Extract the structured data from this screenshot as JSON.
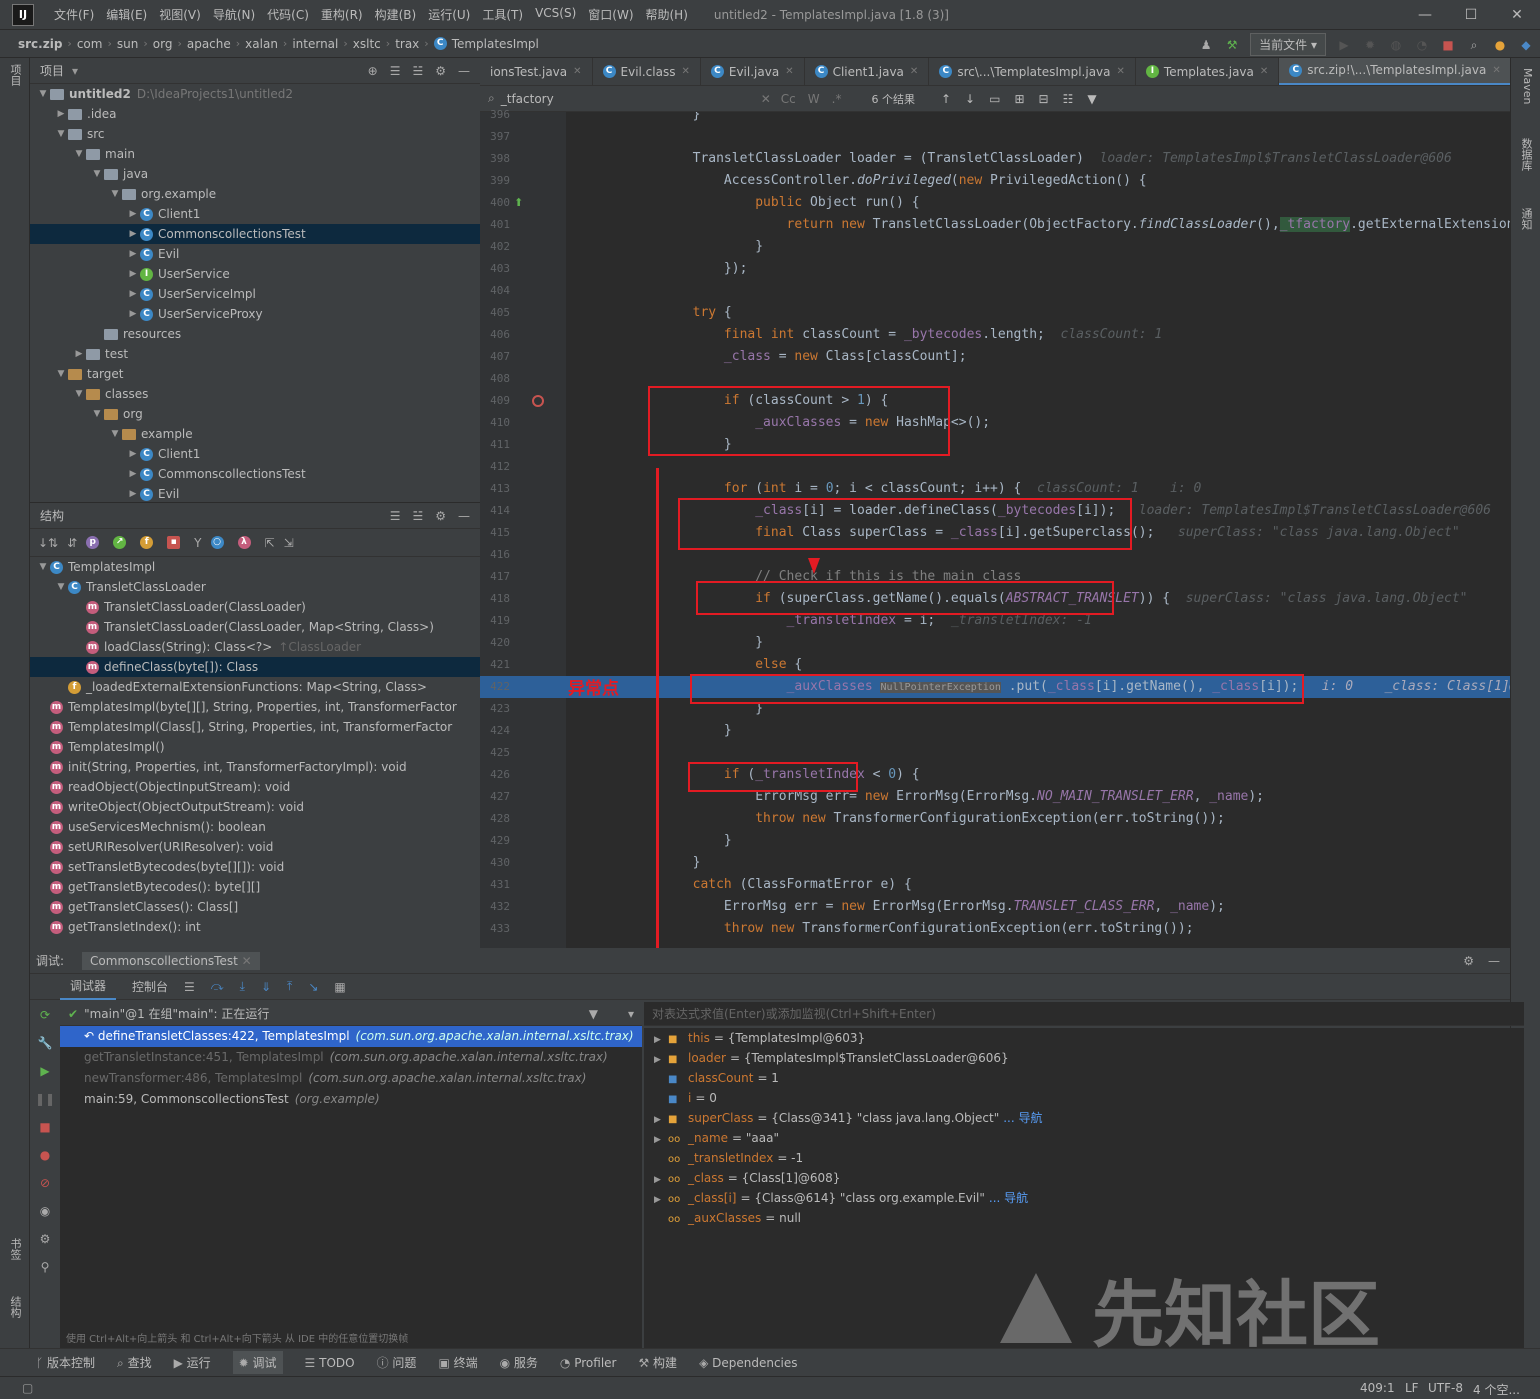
{
  "window": {
    "title": "untitled2 - TemplatesImpl.java [1.8 (3)]",
    "logo": "IJ"
  },
  "menu": [
    "文件(F)",
    "编辑(E)",
    "视图(V)",
    "导航(N)",
    "代码(C)",
    "重构(R)",
    "构建(B)",
    "运行(U)",
    "工具(T)",
    "VCS(S)",
    "窗口(W)",
    "帮助(H)"
  ],
  "breadcrumb": [
    "src.zip",
    "com",
    "sun",
    "org",
    "apache",
    "xalan",
    "internal",
    "xsltc",
    "trax",
    "TemplatesImpl"
  ],
  "run_config": "当前文件",
  "project_panel": {
    "title": "项目",
    "rows": [
      {
        "label": "untitled2",
        "extra": "D:\\IdeaProjects1\\untitled2"
      },
      {
        "label": ".idea"
      },
      {
        "label": "src"
      },
      {
        "label": "main"
      },
      {
        "label": "java"
      },
      {
        "label": "org.example"
      },
      {
        "label": "Client1"
      },
      {
        "label": "CommonscollectionsTest"
      },
      {
        "label": "Evil"
      },
      {
        "label": "UserService"
      },
      {
        "label": "UserServiceImpl"
      },
      {
        "label": "UserServiceProxy"
      },
      {
        "label": "resources"
      },
      {
        "label": "test"
      },
      {
        "label": "target"
      },
      {
        "label": "classes"
      },
      {
        "label": "org"
      },
      {
        "label": "example"
      },
      {
        "label": "Client1"
      },
      {
        "label": "CommonscollectionsTest"
      },
      {
        "label": "Evil"
      }
    ]
  },
  "structure_panel": {
    "title": "结构",
    "rows": [
      {
        "label": "TemplatesImpl"
      },
      {
        "label": "TransletClassLoader"
      },
      {
        "label": "TransletClassLoader(ClassLoader)"
      },
      {
        "label": "TransletClassLoader(ClassLoader, Map<String, Class>)"
      },
      {
        "label": "loadClass(String): Class<?>",
        "extra": "↑ClassLoader"
      },
      {
        "label": "defineClass(byte[]): Class"
      },
      {
        "label": "_loadedExternalExtensionFunctions: Map<String, Class>"
      },
      {
        "label": "TemplatesImpl(byte[][], String, Properties, int, TransformerFactor"
      },
      {
        "label": "TemplatesImpl(Class[], String, Properties, int, TransformerFactor"
      },
      {
        "label": "TemplatesImpl()"
      },
      {
        "label": "init(String, Properties, int, TransformerFactoryImpl): void"
      },
      {
        "label": "readObject(ObjectInputStream): void"
      },
      {
        "label": "writeObject(ObjectOutputStream): void"
      },
      {
        "label": "useServicesMechnism(): boolean"
      },
      {
        "label": "setURIResolver(URIResolver): void"
      },
      {
        "label": "setTransletBytecodes(byte[][]): void"
      },
      {
        "label": "getTransletBytecodes(): byte[][]"
      },
      {
        "label": "getTransletClasses(): Class[]"
      },
      {
        "label": "getTransletIndex(): int"
      }
    ]
  },
  "editor_tabs": [
    "ionsTest.java",
    "Evil.class",
    "Evil.java",
    "Client1.java",
    "src\\...\\TemplatesImpl.java",
    "Templates.java",
    "src.zip!\\...\\TemplatesImpl.java"
  ],
  "find": {
    "query": "_tfactory",
    "results": "6 个结果"
  },
  "annotation": "异常点",
  "debug": {
    "title": "调试:",
    "session": "CommonscollectionsTest",
    "tabs": [
      "调试器",
      "控制台"
    ],
    "thread": "\"main\"@1 在组\"main\": 正在运行",
    "eval_placeholder": "对表达式求值(Enter)或添加监视(Ctrl+Shift+Enter)",
    "frames": [
      {
        "m": "defineTransletClasses:422, TemplatesImpl",
        "p": "(com.sun.org.apache.xalan.internal.xsltc.trax)"
      },
      {
        "m": "getTransletInstance:451, TemplatesImpl",
        "p": "(com.sun.org.apache.xalan.internal.xsltc.trax)"
      },
      {
        "m": "newTransformer:486, TemplatesImpl",
        "p": "(com.sun.org.apache.xalan.internal.xsltc.trax)"
      },
      {
        "m": "main:59, CommonscollectionsTest",
        "p": "(org.example)"
      }
    ],
    "frames_hint": "使用 Ctrl+Alt+向上箭头 和 Ctrl+Alt+向下箭头 从 IDE 中的任意位置切换帧",
    "vars": [
      {
        "n": "this",
        "v": "= {TemplatesImpl@603}"
      },
      {
        "n": "loader",
        "v": "= {TemplatesImpl$TransletClassLoader@606}"
      },
      {
        "n": "classCount",
        "v": "= 1"
      },
      {
        "n": "i",
        "v": "= 0"
      },
      {
        "n": "superClass",
        "v": "= {Class@341} \"class java.lang.Object\"",
        "link": "... 导航"
      },
      {
        "n": "_name",
        "v": "= \"aaa\""
      },
      {
        "n": "_transletIndex",
        "v": "= -1"
      },
      {
        "n": "_class",
        "v": "= {Class[1]@608}"
      },
      {
        "n": "_class[i]",
        "v": "= {Class@614} \"class org.example.Evil\"",
        "link": "... 导航"
      },
      {
        "n": "_auxClasses",
        "v": "= null"
      }
    ]
  },
  "statusbar": [
    "版本控制",
    "查找",
    "运行",
    "调试",
    "TODO",
    "问题",
    "终端",
    "服务",
    "Profiler",
    "构建",
    "Dependencies"
  ],
  "bottom": {
    "pos": "409:1",
    "sep": "LF",
    "enc": "UTF-8",
    "indent": "4 个空..."
  },
  "side_tabs": {
    "left": [
      "项目",
      "书签",
      "结构"
    ],
    "right": [
      "Maven",
      "数据库",
      "通知"
    ]
  },
  "watermark": "先知社区"
}
